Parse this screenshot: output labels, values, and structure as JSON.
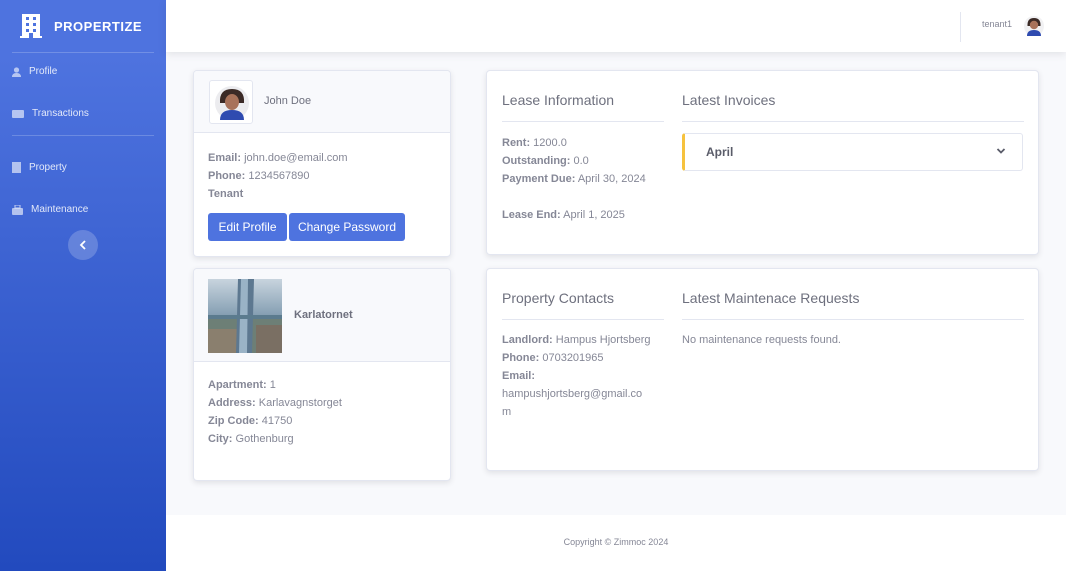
{
  "app": {
    "brand": "PROPERTIZE"
  },
  "sidebar": {
    "items": [
      {
        "label": "Profile",
        "icon": "user-icon"
      },
      {
        "label": "Transactions",
        "icon": "money-icon"
      },
      {
        "label": "Property",
        "icon": "building-icon"
      },
      {
        "label": "Maintenance",
        "icon": "toolbox-icon"
      }
    ]
  },
  "topbar": {
    "username": "tenant1"
  },
  "profile": {
    "name": "John Doe",
    "email_label": "Email:",
    "email": "john.doe@email.com",
    "phone_label": "Phone:",
    "phone": "1234567890",
    "role": "Tenant",
    "edit_button": "Edit Profile",
    "password_button": "Change Password"
  },
  "property": {
    "name": "Karlatornet",
    "apartment_label": "Apartment:",
    "apartment": "1",
    "address_label": "Address:",
    "address": "Karlavagnstorget",
    "zip_label": "Zip Code:",
    "zip": "41750",
    "city_label": "City:",
    "city": "Gothenburg"
  },
  "lease": {
    "title": "Lease Information",
    "rent_label": "Rent:",
    "rent": "1200.0",
    "outstanding_label": "Outstanding:",
    "outstanding": "0.0",
    "due_label": "Payment Due:",
    "due": "April 30, 2024",
    "end_label": "Lease End:",
    "end": "April 1, 2025"
  },
  "invoices": {
    "title": "Latest Invoices",
    "items": [
      {
        "label": "April"
      }
    ]
  },
  "contacts": {
    "title": "Property Contacts",
    "landlord_label": "Landlord:",
    "landlord": "Hampus Hjortsberg",
    "phone_label": "Phone:",
    "phone": "0703201965",
    "email_label": "Email:",
    "email_line1": "hampushjortsberg@gmail.co",
    "email_line2": "m"
  },
  "maintenance": {
    "title": "Latest Maintenace Requests",
    "empty": "No maintenance requests found."
  },
  "footer": {
    "copyright": "Copyright © Zimmoc 2024"
  },
  "colors": {
    "primary": "#4e73df",
    "warning": "#f6c23e",
    "text": "#858796"
  }
}
